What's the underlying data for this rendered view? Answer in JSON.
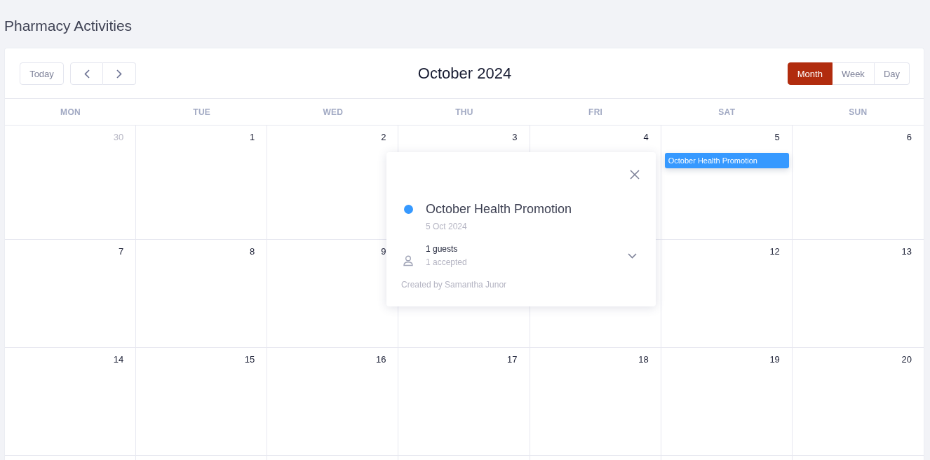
{
  "page": {
    "title": "Pharmacy Activities"
  },
  "toolbar": {
    "today_button": "Today",
    "month_title": "October 2024",
    "views": [
      {
        "label": "Month",
        "selected": true
      },
      {
        "label": "Week",
        "selected": false
      },
      {
        "label": "Day",
        "selected": false
      }
    ]
  },
  "weekdays": [
    "MON",
    "TUE",
    "WED",
    "THU",
    "FRI",
    "SAT",
    "SUN"
  ],
  "weeks": [
    {
      "mon": {
        "day": "30",
        "outside_month": true
      },
      "tue": {
        "day": "1",
        "outside_month": false
      },
      "wed": {
        "day": "2",
        "outside_month": false
      },
      "thu": {
        "day": "3",
        "outside_month": false
      },
      "fri": {
        "day": "4",
        "outside_month": false
      },
      "sat": {
        "day": "5",
        "outside_month": false,
        "events": [
          {
            "title": "October Health Promotion",
            "color": "#3699ff"
          }
        ]
      },
      "sun": {
        "day": "6",
        "outside_month": false
      }
    },
    {
      "mon": {
        "day": "7",
        "outside_month": false
      },
      "tue": {
        "day": "8",
        "outside_month": false
      },
      "wed": {
        "day": "9",
        "outside_month": false
      },
      "sat": {
        "day": "12",
        "outside_month": false
      },
      "sun": {
        "day": "13",
        "outside_month": false
      }
    },
    {
      "mon": {
        "day": "14",
        "outside_month": false
      },
      "tue": {
        "day": "15",
        "outside_month": false
      },
      "wed": {
        "day": "16",
        "outside_month": false
      },
      "thu": {
        "day": "17",
        "outside_month": false
      },
      "fri": {
        "day": "18",
        "outside_month": false
      },
      "sat": {
        "day": "19",
        "outside_month": false
      },
      "sun": {
        "day": "20",
        "outside_month": false
      }
    }
  ],
  "popover": {
    "title": "October Health Promotion",
    "color": "#3699ff",
    "date": "5 Oct 2024",
    "guests": "1 guests",
    "accepted": "1 accepted",
    "created_by": "Created by Samantha Junor"
  }
}
